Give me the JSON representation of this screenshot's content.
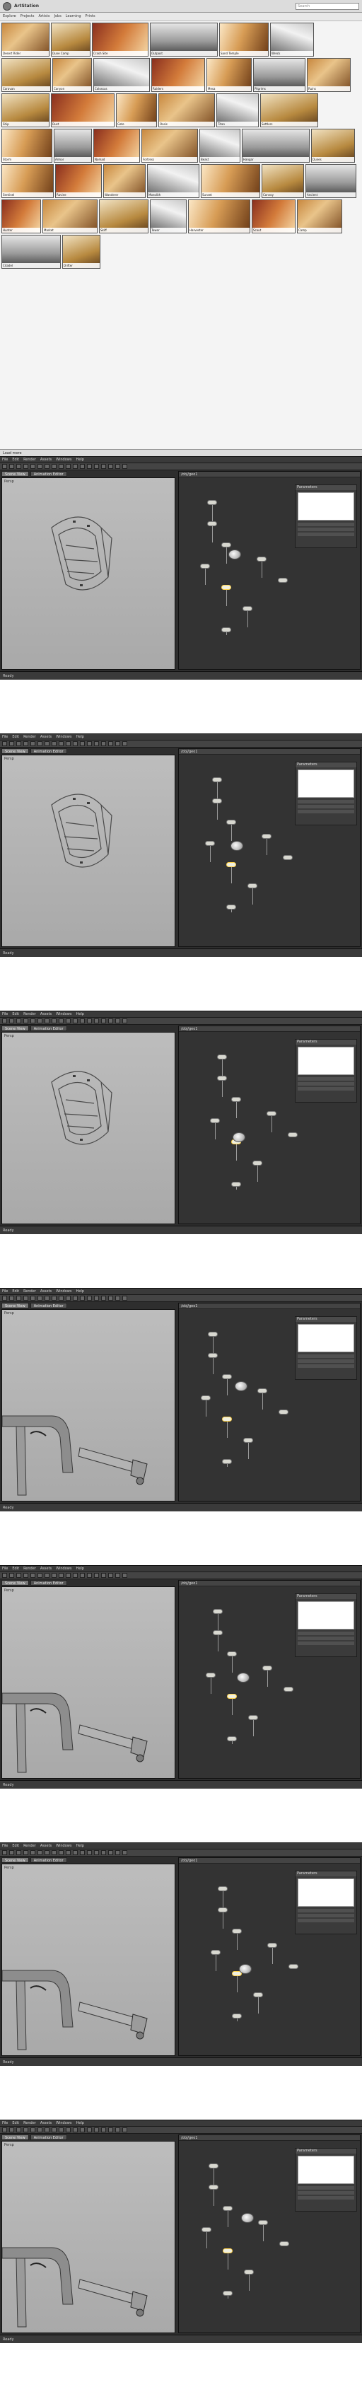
{
  "gallery": {
    "title": "ArtStation",
    "search_placeholder": "Search",
    "nav": [
      "Explore",
      "Projects",
      "Artists",
      "Jobs",
      "Learning",
      "Prints"
    ],
    "thumbs": [
      {
        "cap": "Desert Rider",
        "c": "t-a",
        "w": 68
      },
      {
        "cap": "Dune Camp",
        "c": "t-b",
        "w": 56
      },
      {
        "cap": "Crash Site",
        "c": "t-c",
        "w": 80
      },
      {
        "cap": "Outpost",
        "c": "t-d",
        "w": 96
      },
      {
        "cap": "Sand Temple",
        "c": "t-e",
        "w": 70
      },
      {
        "cap": "Wreck",
        "c": "t-f",
        "w": 62
      },
      {
        "cap": "Caravan",
        "c": "t-b",
        "w": 70
      },
      {
        "cap": "Canyon",
        "c": "t-a",
        "w": 56
      },
      {
        "cap": "Colossus",
        "c": "t-f",
        "w": 80
      },
      {
        "cap": "Raiders",
        "c": "t-c",
        "w": 76
      },
      {
        "cap": "Mesa",
        "c": "t-e",
        "w": 64
      },
      {
        "cap": "Pilgrims",
        "c": "t-d",
        "w": 74
      },
      {
        "cap": "Ruins",
        "c": "t-a",
        "w": 62
      },
      {
        "cap": "Ship",
        "c": "t-b",
        "w": 68
      },
      {
        "cap": "Dust",
        "c": "t-c",
        "w": 90
      },
      {
        "cap": "Gate",
        "c": "t-e",
        "w": 58
      },
      {
        "cap": "Oasis",
        "c": "t-a",
        "w": 80
      },
      {
        "cap": "Titan",
        "c": "t-f",
        "w": 60
      },
      {
        "cap": "Settlers",
        "c": "t-b",
        "w": 82
      },
      {
        "cap": "Storm",
        "c": "t-e",
        "w": 72
      },
      {
        "cap": "Armor",
        "c": "t-d",
        "w": 54
      },
      {
        "cap": "Nomad",
        "c": "t-c",
        "w": 66
      },
      {
        "cap": "Fortress",
        "c": "t-a",
        "w": 80
      },
      {
        "cap": "Beast",
        "c": "t-f",
        "w": 58
      },
      {
        "cap": "Hangar",
        "c": "t-d",
        "w": 96
      },
      {
        "cap": "Dunes",
        "c": "t-b",
        "w": 62
      },
      {
        "cap": "Sentinel",
        "c": "t-e",
        "w": 74
      },
      {
        "cap": "Ravine",
        "c": "t-c",
        "w": 66
      },
      {
        "cap": "Wanderer",
        "c": "t-a",
        "w": 60
      },
      {
        "cap": "Monolith",
        "c": "t-f",
        "w": 74
      },
      {
        "cap": "Sunset",
        "c": "t-e",
        "w": 84
      },
      {
        "cap": "Convoy",
        "c": "t-b",
        "w": 60
      },
      {
        "cap": "Ancient",
        "c": "t-d",
        "w": 72
      },
      {
        "cap": "Hunter",
        "c": "t-c",
        "w": 56
      },
      {
        "cap": "Market",
        "c": "t-a",
        "w": 78
      },
      {
        "cap": "Skiff",
        "c": "t-b",
        "w": 70
      },
      {
        "cap": "Tower",
        "c": "t-f",
        "w": 52
      },
      {
        "cap": "Harvester",
        "c": "t-e",
        "w": 88
      },
      {
        "cap": "Scout",
        "c": "t-c",
        "w": 62
      },
      {
        "cap": "Camp",
        "c": "t-a",
        "w": 64
      },
      {
        "cap": "Citadel",
        "c": "t-d",
        "w": 84
      },
      {
        "cap": "Drifter",
        "c": "t-b",
        "w": 54
      }
    ],
    "footer": "Load more"
  },
  "editor": {
    "menu": [
      "File",
      "Edit",
      "Render",
      "Assets",
      "Windows",
      "Help"
    ],
    "tabs": [
      "Scene View",
      "Animation Editor"
    ],
    "viewport_label": "Persp",
    "ng_header": "/obj/geo1",
    "param_header": "Parameters",
    "status_text": "Ready",
    "panels": [
      {
        "shape": "cage"
      },
      {
        "shape": "cage"
      },
      {
        "shape": "cage"
      },
      {
        "shape": "arch"
      },
      {
        "shape": "arch"
      },
      {
        "shape": "arch"
      },
      {
        "shape": "arch"
      }
    ]
  }
}
